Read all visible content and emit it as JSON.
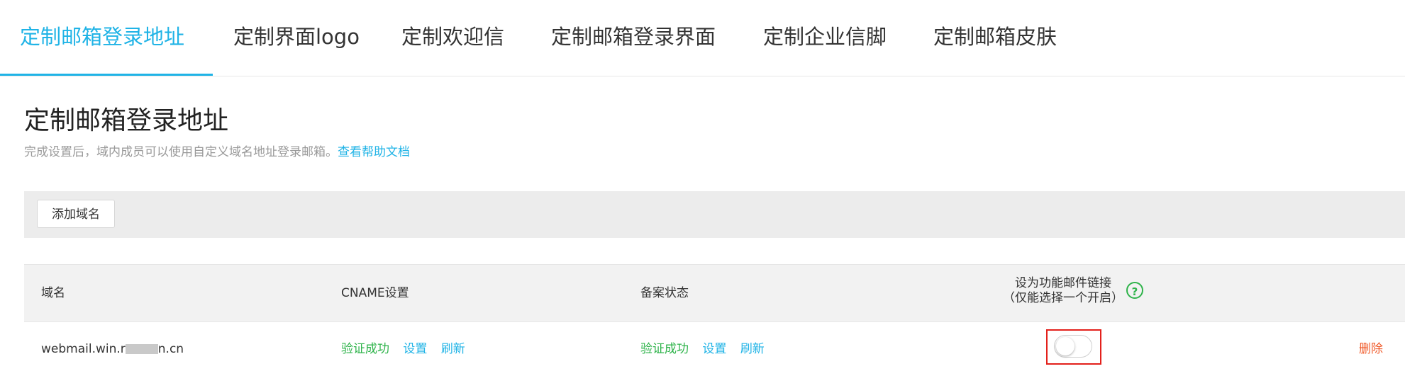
{
  "tabs": [
    {
      "label": "定制邮箱登录地址",
      "active": true
    },
    {
      "label": "定制界面logo",
      "active": false
    },
    {
      "label": "定制欢迎信",
      "active": false
    },
    {
      "label": "定制邮箱登录界面",
      "active": false
    },
    {
      "label": "定制企业信脚",
      "active": false
    },
    {
      "label": "定制邮箱皮肤",
      "active": false
    }
  ],
  "page": {
    "title": "定制邮箱登录地址",
    "subtitle": "完成设置后，域内成员可以使用自定义域名地址登录邮箱。",
    "help_link": "查看帮助文档"
  },
  "toolbar": {
    "add_domain_label": "添加域名"
  },
  "table": {
    "headers": {
      "domain": "域名",
      "cname": "CNAME设置",
      "filing": "备案状态",
      "link_line1": "设为功能邮件链接",
      "link_line2": "（仅能选择一个开启）",
      "help_icon": "?"
    },
    "rows": [
      {
        "domain_prefix": "webmail.win.r",
        "domain_suffix": "n.cn",
        "cname_status": "验证成功",
        "cname_set": "设置",
        "cname_refresh": "刷新",
        "filing_status": "验证成功",
        "filing_set": "设置",
        "filing_refresh": "刷新",
        "link_enabled": false,
        "delete_label": "删除"
      }
    ]
  },
  "colors": {
    "accent": "#1fb3e6",
    "success": "#2eb34a",
    "danger": "#f05b2b",
    "highlight_box": "#e3201b"
  },
  "icons": {
    "help": "question-circle-icon"
  }
}
